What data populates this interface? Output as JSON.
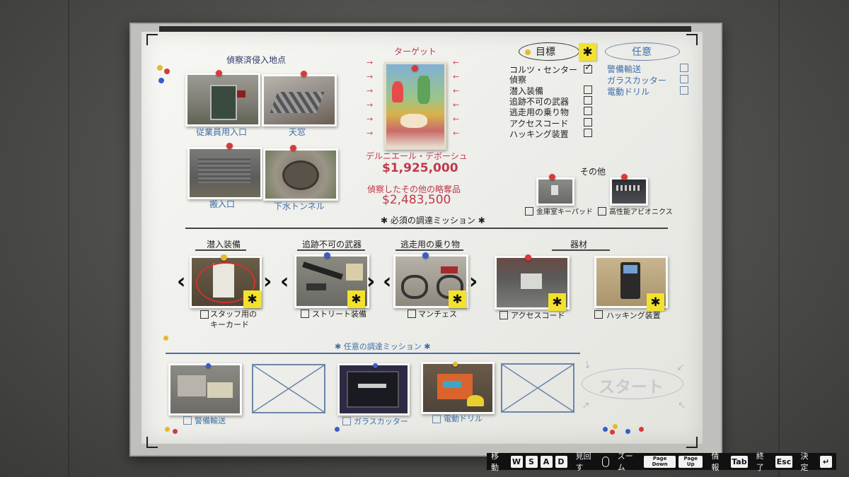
{
  "entry_points": {
    "title": "偵察済侵入地点",
    "items": [
      "従業員用入口",
      "天窓",
      "搬入口",
      "下水トンネル"
    ]
  },
  "target": {
    "title": "ターゲット",
    "name": "デルニエール・デボーシュ",
    "value": "$1,925,000",
    "other_label": "偵察したその他の略奪品",
    "other_value": "$2,483,500"
  },
  "objectives": {
    "header": "目標",
    "optional_header": "任意",
    "items": [
      "コルツ・センター偵察",
      "潜入装備",
      "追跡不可の武器",
      "逃走用の乗り物",
      "アクセスコード",
      "ハッキング装置"
    ],
    "item_line1": "コルツ・センター",
    "item_line2": "偵察",
    "optional_items": [
      "警備輸送",
      "ガラスカッター",
      "電動ドリル"
    ]
  },
  "others": {
    "title": "その他",
    "items": [
      "金庫室キーパッド",
      "高性能アビオニクス"
    ]
  },
  "required_missions": {
    "title": "必須の調達ミッション",
    "categories": [
      "潜入装備",
      "追跡不可の武器",
      "逃走用の乗り物",
      "器材"
    ],
    "items": [
      "スタッフ用のキーカード",
      "ストリート装備",
      "マンチェス",
      "アクセスコード",
      "ハッキング装置"
    ],
    "keycard_line1": "スタッフ用の",
    "keycard_line2": "キーカード"
  },
  "optional_missions": {
    "title": "任意の調達ミッション",
    "items": [
      "警備輸送",
      "ガラスカッター",
      "電動ドリル"
    ],
    "start": "スタート"
  },
  "footer": {
    "move": "移動",
    "keys_move": [
      "W",
      "S",
      "A",
      "D"
    ],
    "look": "見回す",
    "zoom": "ズーム",
    "pagedown": "Page Down",
    "pageup": "Page Up",
    "info": "情報",
    "tab": "Tab",
    "quit": "終了",
    "esc": "Esc",
    "confirm": "決定",
    "enter": "↵"
  },
  "colors": {
    "board": "#f2f2ee",
    "accent_red": "#c0394a",
    "accent_blue": "#3d6fa8",
    "sticky_yellow": "#f3e22c"
  }
}
